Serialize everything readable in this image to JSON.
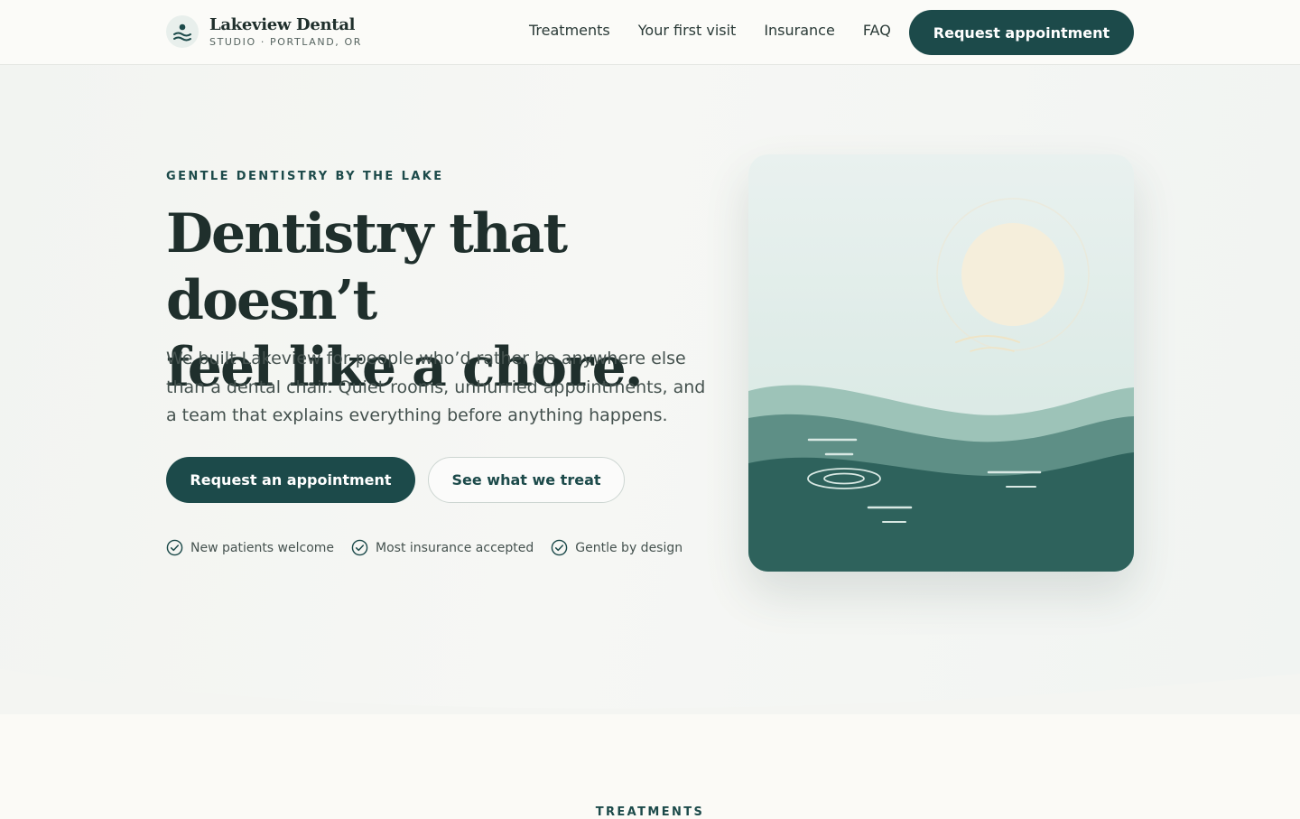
{
  "header": {
    "brand_name": "Lakeview Dental",
    "brand_sub": "STUDIO · PORTLAND, OR",
    "nav": [
      "Treatments",
      "Your first visit",
      "Insurance",
      "FAQ"
    ],
    "cta": "Request appointment"
  },
  "hero": {
    "eyebrow": "GENTLE DENTISTRY BY THE LAKE",
    "headline_line1": "Dentistry that doesn’t",
    "headline_line2": "feel like a chore.",
    "lede": "We built Lakeview for people who’d rather be anywhere else than a dental chair. Quiet rooms, unhurried appointments, and a team that explains everything before anything happens.",
    "primary_cta": "Request an appointment",
    "secondary_cta": "See what we treat",
    "checks": [
      "New patients welcome",
      "Most insurance accepted",
      "Gentle by design"
    ]
  },
  "next_section": {
    "label": "TREATMENTS"
  },
  "colors": {
    "accent": "#1c4a4a",
    "text": "#1f2f2c",
    "water_light": "#9dc3b8",
    "water_mid": "#5e8f86",
    "water_dark": "#2e625c",
    "sun": "#f5eedb"
  },
  "icons": {
    "logo": "person-over-waves-icon",
    "check": "check-circle-icon"
  }
}
